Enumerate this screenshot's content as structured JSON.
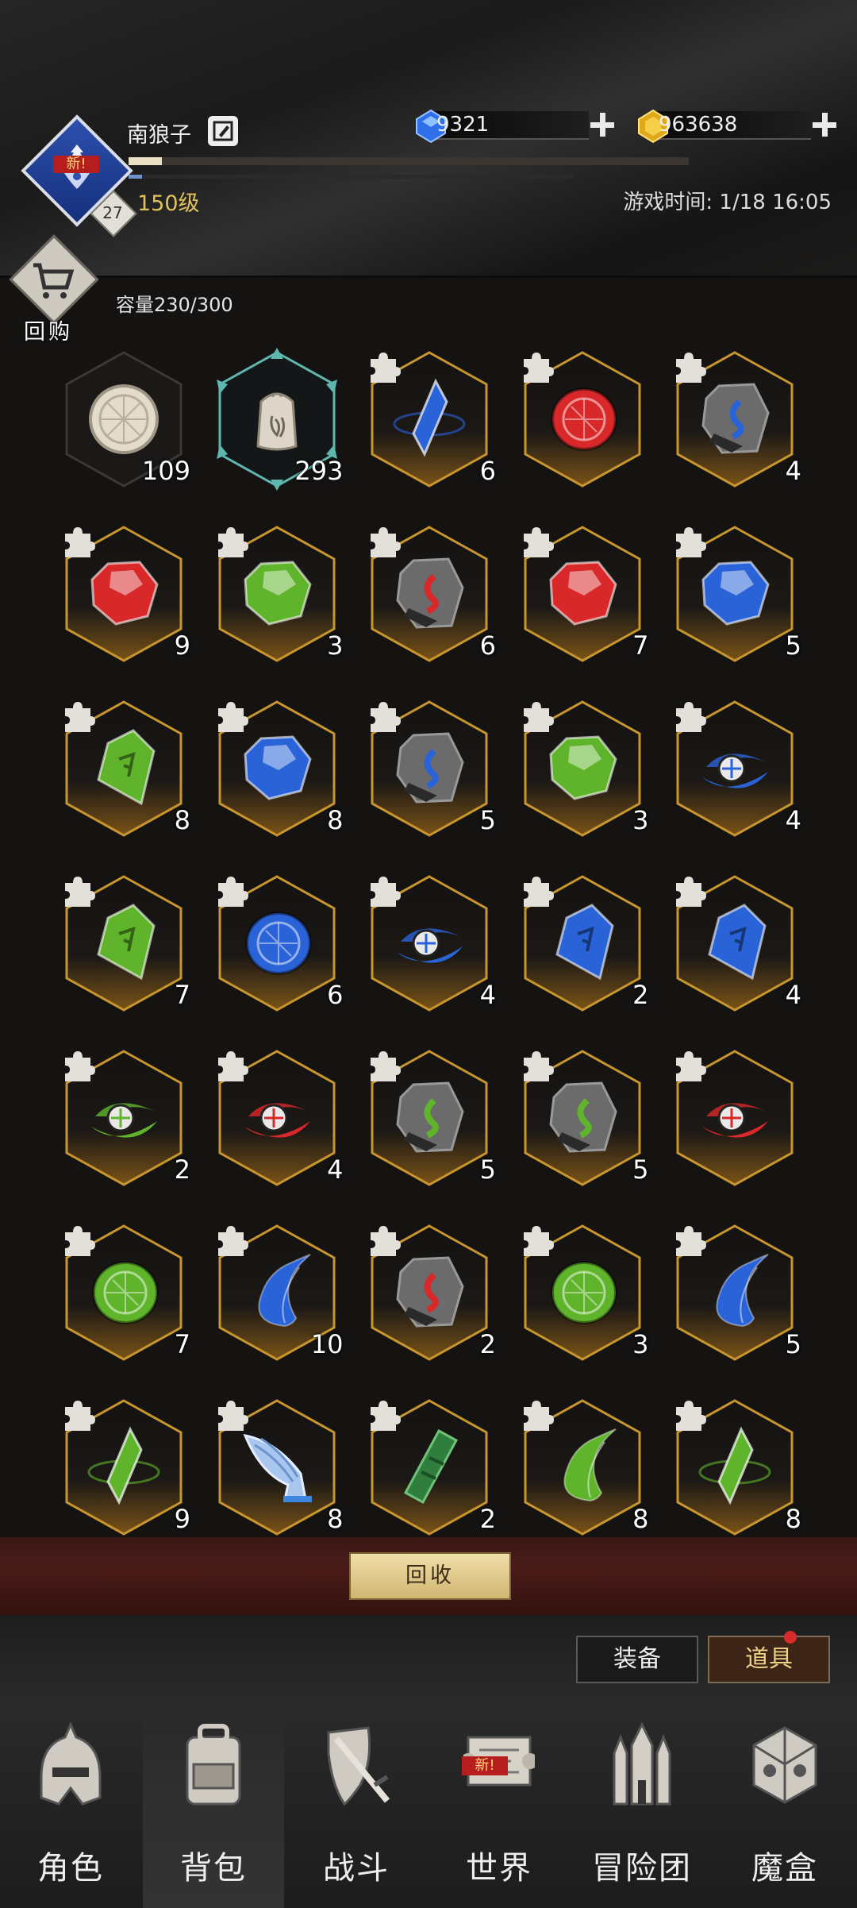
{
  "player": {
    "name": "南狼子",
    "level_text": "150级",
    "avatar_level": "27",
    "new_badge": "新!",
    "xp_progress": 0.06,
    "secondary_progress": 0.03
  },
  "currency": {
    "diamonds": "9321",
    "gold": "963638"
  },
  "game_time": "游戏时间: 1/18 16:05",
  "repurchase_label": "回购",
  "capacity": "容量230/300",
  "items": [
    {
      "icon": "mooncake",
      "count": "109",
      "frame": "dark"
    },
    {
      "icon": "salt-shaker",
      "count": "293",
      "frame": "teal"
    },
    {
      "icon": "blue-crystal-shard",
      "count": "6",
      "frame": "gold"
    },
    {
      "icon": "red-rune-coin",
      "count": "",
      "frame": "gold"
    },
    {
      "icon": "blue-vein-rock",
      "count": "4",
      "frame": "gold"
    },
    {
      "icon": "red-gem",
      "count": "9",
      "frame": "gold"
    },
    {
      "icon": "green-gem",
      "count": "3",
      "frame": "gold"
    },
    {
      "icon": "red-vein-rock",
      "count": "6",
      "frame": "gold"
    },
    {
      "icon": "red-gem",
      "count": "7",
      "frame": "gold"
    },
    {
      "icon": "blue-gem",
      "count": "5",
      "frame": "gold"
    },
    {
      "icon": "green-rune-crystal",
      "count": "8",
      "frame": "gold"
    },
    {
      "icon": "blue-gem",
      "count": "8",
      "frame": "gold"
    },
    {
      "icon": "blue-vein-rock",
      "count": "5",
      "frame": "gold"
    },
    {
      "icon": "green-gem",
      "count": "3",
      "frame": "gold"
    },
    {
      "icon": "blue-eye-swirl",
      "count": "4",
      "frame": "gold"
    },
    {
      "icon": "green-rune-crystal",
      "count": "7",
      "frame": "gold"
    },
    {
      "icon": "blue-rune-coin",
      "count": "6",
      "frame": "gold"
    },
    {
      "icon": "blue-eye-swirl",
      "count": "4",
      "frame": "gold"
    },
    {
      "icon": "blue-rune-crystal",
      "count": "2",
      "frame": "gold"
    },
    {
      "icon": "blue-rune-crystal",
      "count": "4",
      "frame": "gold"
    },
    {
      "icon": "green-eye-swirl",
      "count": "2",
      "frame": "gold"
    },
    {
      "icon": "red-eye-swirl",
      "count": "4",
      "frame": "gold"
    },
    {
      "icon": "green-vein-rock",
      "count": "5",
      "frame": "gold"
    },
    {
      "icon": "green-vein-rock",
      "count": "5",
      "frame": "gold"
    },
    {
      "icon": "red-eye-swirl",
      "count": "",
      "frame": "gold"
    },
    {
      "icon": "green-rune-coin",
      "count": "7",
      "frame": "gold"
    },
    {
      "icon": "blue-feather",
      "count": "10",
      "frame": "gold"
    },
    {
      "icon": "red-vein-rock",
      "count": "2",
      "frame": "gold"
    },
    {
      "icon": "green-rune-coin",
      "count": "3",
      "frame": "gold"
    },
    {
      "icon": "blue-feather",
      "count": "5",
      "frame": "gold"
    },
    {
      "icon": "green-crystal-shard",
      "count": "9",
      "frame": "gold"
    },
    {
      "icon": "blue-wing",
      "count": "8",
      "frame": "gold"
    },
    {
      "icon": "green-rod",
      "count": "2",
      "frame": "gold"
    },
    {
      "icon": "green-feather",
      "count": "8",
      "frame": "gold"
    },
    {
      "icon": "green-crystal-shard",
      "count": "8",
      "frame": "gold"
    }
  ],
  "recycle_label": "回收",
  "sub_tabs": [
    {
      "label": "装备",
      "active": false
    },
    {
      "label": "道具",
      "active": true
    }
  ],
  "nav": [
    {
      "label": "角色",
      "icon": "helmet-icon"
    },
    {
      "label": "背包",
      "icon": "backpack-icon"
    },
    {
      "label": "战斗",
      "icon": "sword-shield-icon"
    },
    {
      "label": "世界",
      "icon": "scroll-map-icon"
    },
    {
      "label": "冒险团",
      "icon": "castle-icon"
    },
    {
      "label": "魔盒",
      "icon": "magic-box-icon"
    }
  ],
  "nav_new_badge": "新!",
  "colors": {
    "gold_frame": "#c9962e",
    "teal_frame": "#5fb8b0",
    "accent_red": "#b61e1e"
  }
}
